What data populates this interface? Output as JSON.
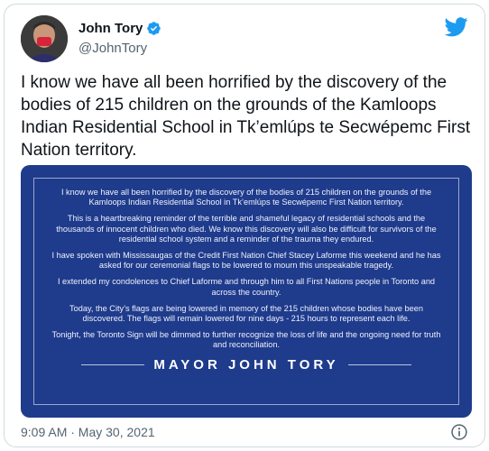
{
  "author": {
    "name": "John Tory",
    "handle": "@JohnTory"
  },
  "tweet": {
    "text": "I know we have all been horrified by the discovery of the bodies of 215 children on the grounds of the Kamloops Indian Residential School in Tk’emlúps te Secwépemc First Nation territory."
  },
  "statement": {
    "paragraphs": [
      "I know we have all been horrified by the discovery of the bodies of 215 children on the grounds of the Kamloops Indian Residential School in Tk’emlúps te Secwépemc First Nation territory.",
      "This is a heartbreaking reminder of the terrible and shameful legacy of residential schools and the thousands of innocent children who died. We know this discovery will also be difficult for survivors of the residential school system and a reminder of the trauma they endured.",
      "I have spoken with Mississaugas of the Credit First Nation Chief Stacey Laforme this weekend and he has asked for our ceremonial flags to be lowered to mourn this unspeakable tragedy.",
      "I extended my condolences to Chief Laforme and through him to all First Nations people in Toronto and across the country.",
      "Today, the City’s flags are being lowered in memory of the 215 children whose bodies have been discovered. The flags will remain lowered for nine days - 215 hours to represent each life.",
      "Tonight, the Toronto Sign will be dimmed to further recognize the loss of life and the ongoing need for truth and reconciliation."
    ],
    "signature": "MAYOR JOHN TORY"
  },
  "footer": {
    "timestamp": "9:09 AM · May 30, 2021"
  },
  "icons": {
    "verified": "verified-badge-icon",
    "brand": "twitter-bird-icon",
    "info": "info-icon"
  },
  "colors": {
    "statement_background": "#1f3b8c",
    "twitter_blue": "#1d9bf0",
    "secondary_text": "#536471"
  }
}
